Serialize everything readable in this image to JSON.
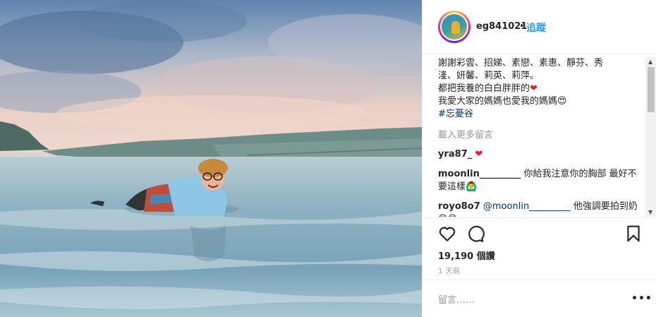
{
  "post": {
    "photo_alt": "",
    "colors": {
      "link": "#3897f0",
      "hashtag": "#003569",
      "muted": "#999999",
      "heart": "#ed1c24"
    }
  },
  "header": {
    "username": "eg841021",
    "separator": "•",
    "follow_label": "追蹤"
  },
  "caption": {
    "lines": [
      "謝謝彩雲、招娣、素戀、素惠、靜芬、秀",
      "湰、妍馨、莉英、莉萍。",
      "都把我養的白白胖胖的"
    ],
    "heart_1": "❤",
    "line4": "我愛大家的媽媽也愛我的媽媽",
    "emoji_1": "😍",
    "hashtag": "#忘憂谷"
  },
  "load_more": "載入更多留言",
  "comments": [
    {
      "user": "yra87_",
      "text": "",
      "emoji": "❤"
    },
    {
      "user": "moonlin_________",
      "text": "你給我注意你的胸部 最好不要這樣🙆‍♂"
    },
    {
      "user": "royo8o7",
      "mention": "@moonlin_________",
      "text": "他強調要拍到奶😅😅"
    }
  ],
  "icons": {
    "like": "heart-outline-icon",
    "comment": "speech-bubble-icon",
    "save": "bookmark-icon",
    "more": "ellipsis-icon",
    "scroll_up": "▲",
    "scroll_down": "▼"
  },
  "likes": "19,190 個讚",
  "timestamp": "1 天前",
  "comment_input": {
    "placeholder": "留言……",
    "value": ""
  },
  "more_label": "•••"
}
